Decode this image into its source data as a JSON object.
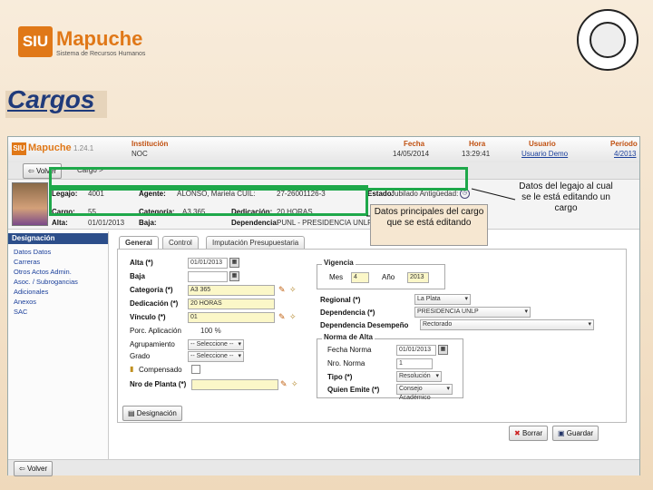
{
  "logo": {
    "badge": "SIU",
    "name": "Mapuche",
    "subtitle": "Sistema de Recursos Humanos"
  },
  "slide_title": "Cargos",
  "app": {
    "badge": "SIU",
    "name": "Mapuche",
    "version": "1.24.1",
    "header": {
      "institucion_label": "Institución",
      "institucion_value": "NOC",
      "fecha_label": "Fecha",
      "fecha_value": "14/05/2014",
      "hora_label": "Hora",
      "hora_value": "13:29:41",
      "usuario_label": "Usuario",
      "usuario_value": "Usuario Demo",
      "periodo_label": "Período",
      "periodo_value": "4/2013"
    },
    "volver_label": "Volver",
    "breadcrumb": "Cargo >",
    "legajo": {
      "legajo_label": "Legajo:",
      "legajo_value": "4001",
      "agente_label": "Agente:",
      "agente_value": "ALONSO, Mariela CUIL:",
      "cuil_value": "27-26001126-3",
      "estado_label": "Estado:",
      "estado_value": "Jubilado Antigüedad:",
      "cargo_label": "Cargo:",
      "cargo_value": "55",
      "categoria_label": "Categoría:",
      "categoria_value": "A3 365",
      "dedicacion_label": "Dedicación:",
      "dedicacion_value": "20 HORAS",
      "alta_label": "Alta:",
      "alta_value": "01/01/2013",
      "baja_label": "Baja:",
      "dependencia_label": "Dependencia:",
      "dependencia_value": "PUNL - PRESIDENCIA UNLP"
    },
    "sidebar": {
      "header": "Designación",
      "items": [
        "Datos Datos",
        "Carreras",
        "Otros Actos Admin.",
        "Asoc. / Subrogancias",
        "Adicionales",
        "Anexos",
        "SAC"
      ]
    },
    "tabs": [
      "General",
      "Control",
      "Imputación Presupuestaria"
    ],
    "form": {
      "alta_label": "Alta (*)",
      "alta_value": "01/01/2013",
      "baja_label": "Baja",
      "categoria_label": "Categoría (*)",
      "categoria_value": "A3 365",
      "dedicacion_label": "Dedicación (*)",
      "dedicacion_value": "20 HORAS",
      "vinculo_label": "Vínculo (*)",
      "vinculo_value": "01",
      "porc_label": "Porc. Aplicación",
      "porc_value": "100 %",
      "agrupamiento_label": "Agrupamiento",
      "agrupamiento_value": "-- Seleccione --",
      "grado_label": "Grado",
      "grado_value": "-- Seleccione --",
      "compensacion_label": "Compensado",
      "nro_planta_label": "Nro de Planta (*)",
      "vigencia_legend": "Vigencia",
      "mes_label": "Mes",
      "mes_value": "4",
      "anio_label": "Año",
      "anio_value": "2013",
      "regional_label": "Regional (*)",
      "regional_value": "La Plata",
      "dependencia_label": "Dependencia (*)",
      "dependencia_value": "PRESIDENCIA UNLP",
      "dep_desempeno_label": "Dependencia Desempeño",
      "dep_desempeno_value": "Rectorado",
      "norma_legend": "Norma de Alta",
      "fecha_norma_label": "Fecha Norma",
      "fecha_norma_value": "01/01/2013",
      "nro_norma_label": "Nro. Norma",
      "nro_norma_value": "1",
      "tipo_label": "Tipo (*)",
      "tipo_value": "Resolución",
      "quien_label": "Quien Emite (*)",
      "quien_value": "Consejo Académico"
    },
    "designacion_button": "Designación",
    "borrar_button": "Borrar",
    "guardar_button": "Guardar",
    "volver_bottom": "Volver"
  },
  "callouts": {
    "cargo": "Datos principales del cargo que se está editando",
    "legajo": "Datos del legajo al cual se le está editando un cargo"
  },
  "colors": {
    "accent": "#e07818",
    "title": "#1f3a7a",
    "highlight": "#1ea84a",
    "nav": "#2c4e8a"
  }
}
